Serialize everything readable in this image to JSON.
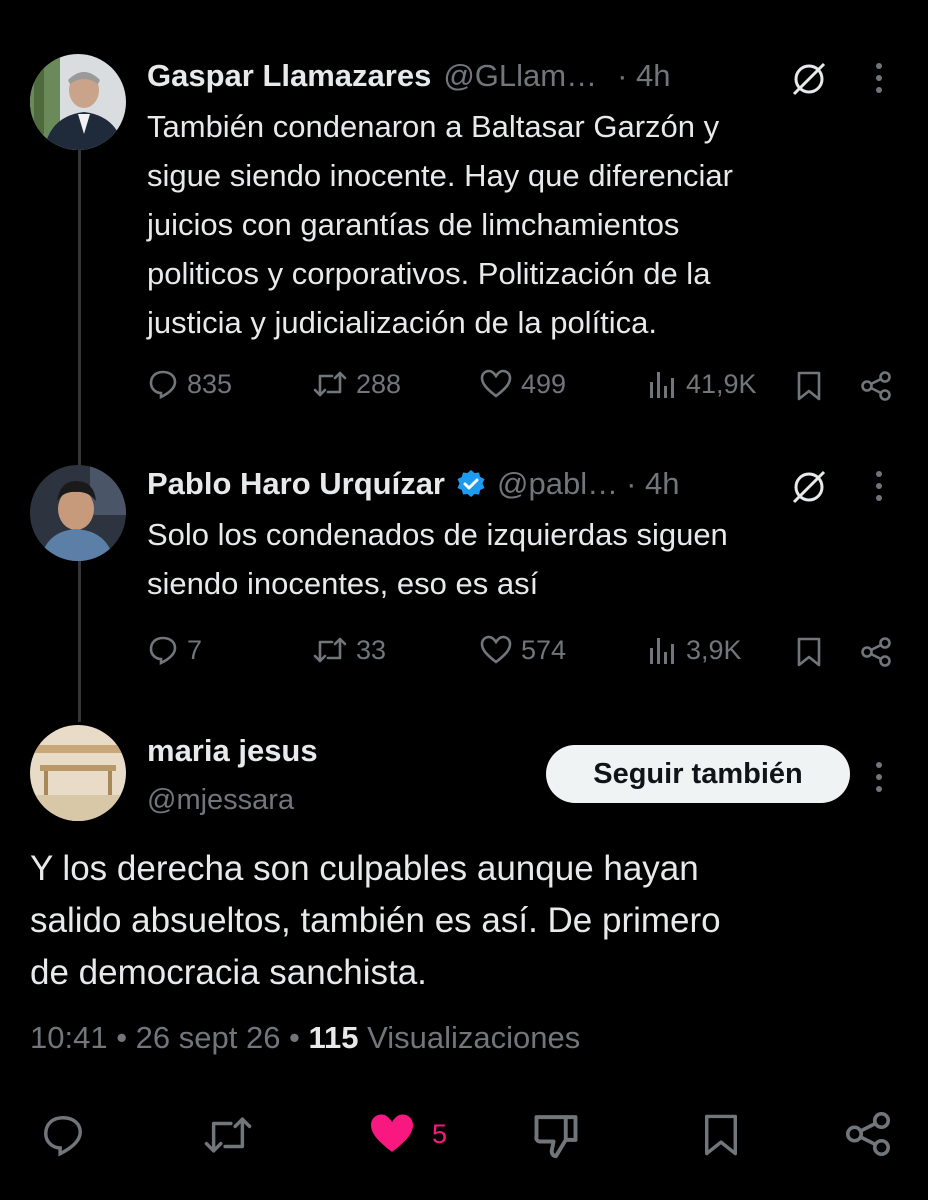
{
  "tweets": [
    {
      "author_name": "Gaspar Llamazares",
      "handle": "@GLlam…",
      "time": "· 4h",
      "verified": false,
      "text_lines": [
        "También condenaron a Baltasar Garzón y",
        "sigue siendo inocente. Hay que diferenciar",
        "juicios con garantías de limchamientos",
        "politicos y corporativos. Politización de la",
        "justicia y judicialización de la política."
      ],
      "replies": "835",
      "retweets": "288",
      "likes": "499",
      "views": "41,9K"
    },
    {
      "author_name": "Pablo Haro Urquízar",
      "handle": "@pabl…",
      "time": "· 4h",
      "verified": true,
      "text_lines": [
        "Solo los condenados de izquierdas siguen",
        "siendo inocentes, eso es así"
      ],
      "replies": "7",
      "retweets": "33",
      "likes": "574",
      "views": "3,9K"
    }
  ],
  "main_tweet": {
    "author_name": "maria jesus",
    "handle": "@mjessara",
    "follow_label": "Seguir también",
    "text_lines": [
      "Y los derecha son culpables aunque hayan",
      "salido absueltos, también es así. De primero",
      "de democracia sanchista."
    ],
    "meta_time": "10:41 • 26 sept 26 •",
    "meta_views_count": "115",
    "meta_views_label": "Visualizaciones",
    "likes": "5"
  },
  "colors": {
    "background": "#000000",
    "text": "#e7e9ea",
    "muted": "#71767b",
    "like_pink": "#f91880",
    "verified_blue": "#1d9bf0"
  }
}
